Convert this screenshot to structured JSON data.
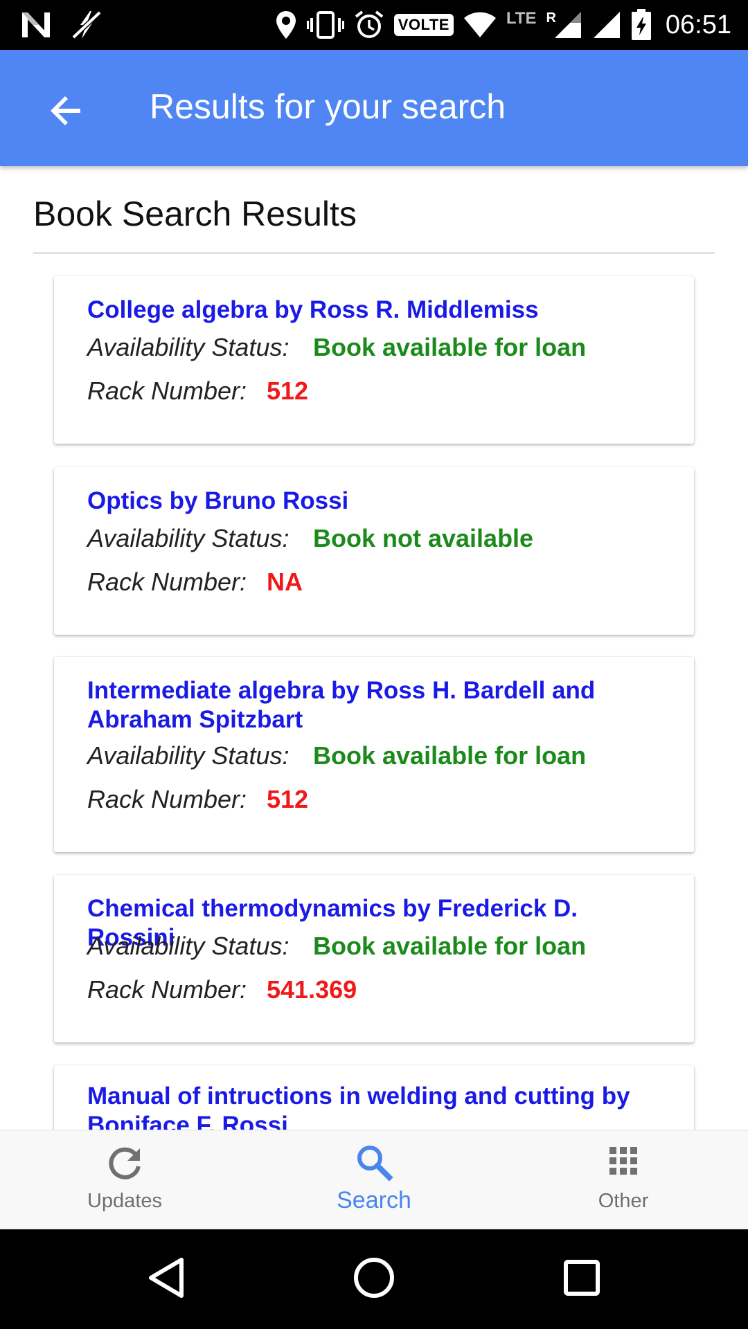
{
  "status_bar": {
    "time": "06:51",
    "volte": "VOLTE",
    "lte": "LTE",
    "roaming": "R",
    "icons": [
      "notification-n-icon",
      "no-flash-icon",
      "location-icon",
      "vibrate-icon",
      "alarm-icon",
      "volte-badge",
      "wifi-icon",
      "signal-icon",
      "signal-icon-2",
      "battery-charging-icon"
    ]
  },
  "app_bar": {
    "title": "Results for your search",
    "back_icon": "arrow-back-icon"
  },
  "page": {
    "heading": "Book Search Results"
  },
  "labels": {
    "availability": "Availability Status:",
    "rack": "Rack Number:"
  },
  "results": [
    {
      "title": "College algebra by Ross R. Middlemiss",
      "status": "Book available for loan",
      "rack": "512"
    },
    {
      "title": "Optics by Bruno Rossi",
      "status": "Book not available",
      "rack": "NA"
    },
    {
      "title": "Intermediate algebra by Ross H. Bardell and Abraham Spitzbart",
      "status": "Book available for loan",
      "rack": "512"
    },
    {
      "title": "Chemical thermodynamics by Frederick D. Rossini",
      "status": "Book available for loan",
      "rack": "541.369"
    },
    {
      "title": "Manual of intructions in welding and cutting by Boniface F. Rossi"
    }
  ],
  "bottom_nav": {
    "items": [
      {
        "label": "Updates",
        "icon": "refresh-icon",
        "active": false
      },
      {
        "label": "Search",
        "icon": "search-icon",
        "active": true
      },
      {
        "label": "Other",
        "icon": "apps-grid-icon",
        "active": false
      }
    ]
  },
  "colors": {
    "app_bar": "#4f86f3",
    "title_link": "#1a1ae6",
    "status_green": "#1b8a1b",
    "rack_red": "#f01818",
    "nav_active": "#4a85ee",
    "nav_inactive": "#6f6f6f"
  }
}
